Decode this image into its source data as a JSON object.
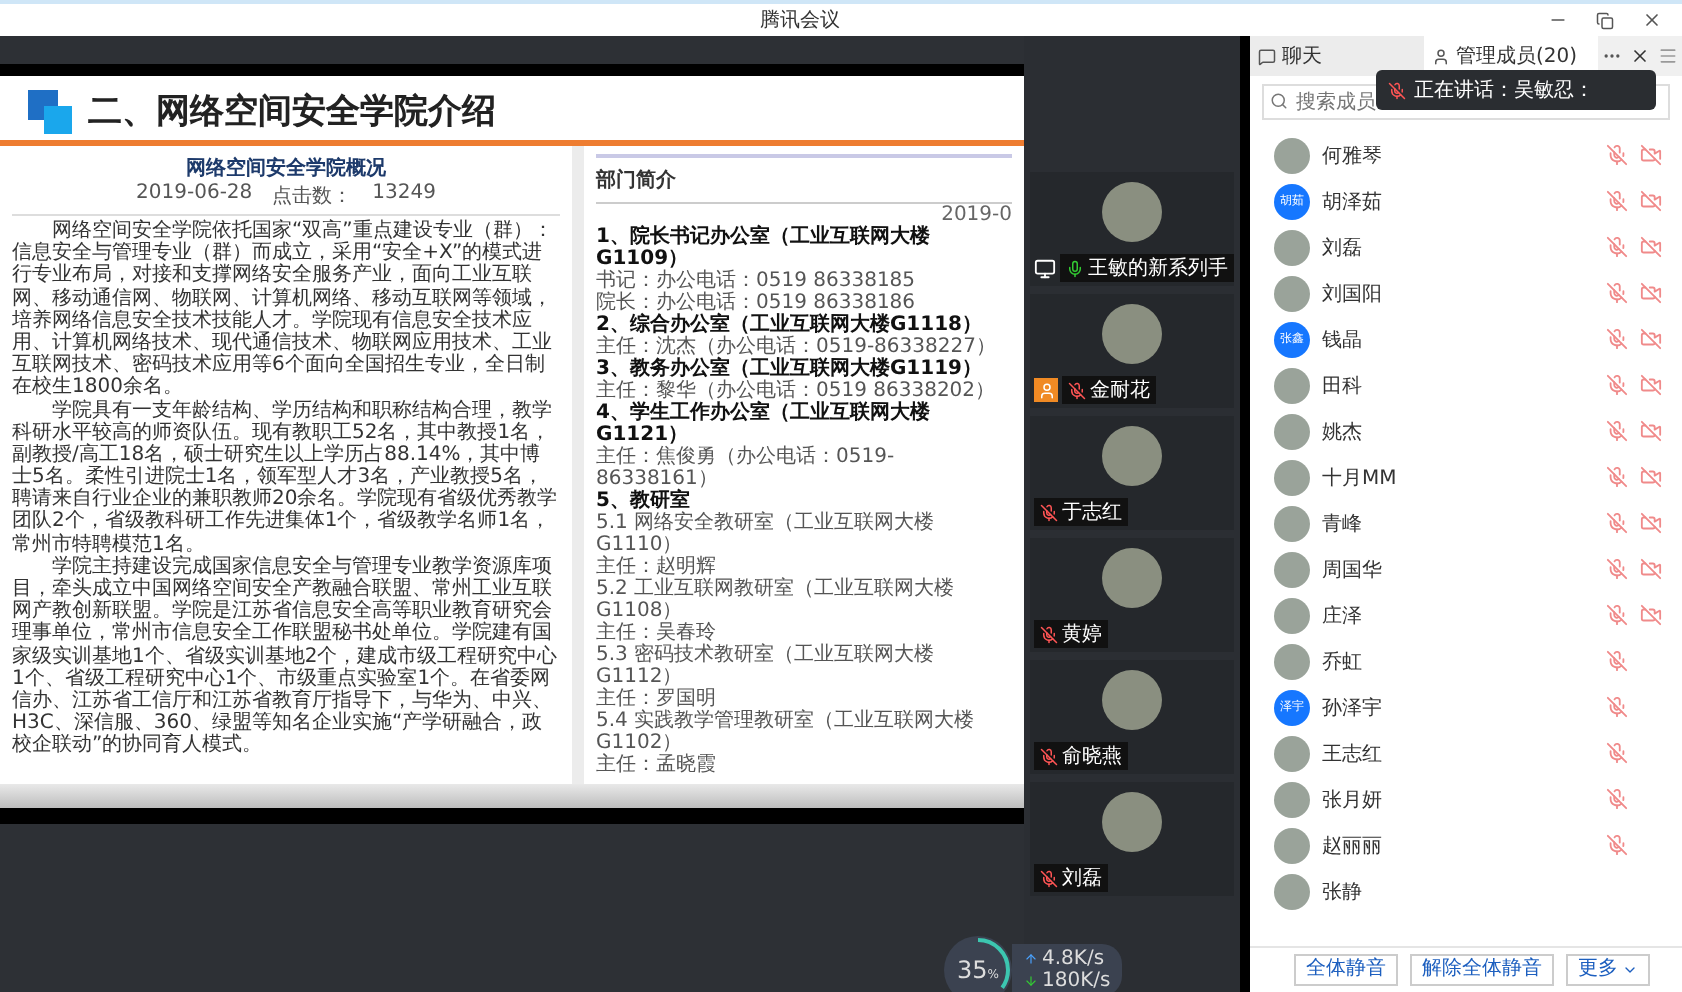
{
  "window": {
    "title": "腾讯会议"
  },
  "slide": {
    "heading": "二、网络空间安全学院介绍",
    "article": {
      "title": "网络空间安全学院概况",
      "date": "2019-06-28",
      "views_label": "点击数：",
      "views": "13249",
      "paragraphs": [
        "网络空间安全学院依托国家“双高”重点建设专业（群）：信息安全与管理专业（群）而成立，采用“安全+X”的模式进行专业布局，对接和支撑网络安全服务产业，面向工业互联网、移动通信网、物联网、计算机网络、移动互联网等领域，培养网络信息安全技术技能人才。学院现有信息安全技术应用、计算机网络技术、现代通信技术、物联网应用技术、工业互联网技术、密码技术应用等6个面向全国招生专业，全日制在校生1800余名。",
        "学院具有一支年龄结构、学历结构和职称结构合理，教学科研水平较高的师资队伍。现有教职工52名，其中教授1名，副教授/高工18名，硕士研究生以上学历占88.14%，其中博士5名。柔性引进院士1名，领军型人才3名，产业教授5名，聘请来自行业企业的兼职教师20余名。学院现有省级优秀教学团队2个，省级教科研工作先进集体1个，省级教学名师1名，常州市特聘模范1名。",
        "学院主持建设完成国家信息安全与管理专业教学资源库项目，牵头成立中国网络空间安全产教融合联盟、常州工业互联网产教创新联盟。学院是江苏省信息安全高等职业教育研究会理事单位，常州市信息安全工作联盟秘书处单位。学院建有国家级实训基地1个、省级实训基地2个，建成市级工程研究中心1个、省级工程研究中心1个、市级重点实验室1个。在省委网信办、江苏省工信厅和江苏省教育厅指导下，与华为、中兴、H3C、深信服、360、绿盟等知名企业实施“产学研融合，政校企联动”的协同育人模式。"
      ]
    },
    "sidebar": {
      "title": "部门简介",
      "date": "2019-0",
      "items": [
        {
          "kind": "heading",
          "text": "1、院长书记办公室（工业互联网大楼G1109）"
        },
        {
          "kind": "line",
          "text": "书记：办公电话：0519 86338185"
        },
        {
          "kind": "line",
          "text": "院长：办公电话：0519 86338186"
        },
        {
          "kind": "heading",
          "text": "2、综合办公室（工业互联网大楼G1118）"
        },
        {
          "kind": "line",
          "text": "主任：沈杰（办公电话：0519-86338227）"
        },
        {
          "kind": "heading",
          "text": "3、教务办公室（工业互联网大楼G1119）"
        },
        {
          "kind": "line",
          "text": "主任：黎华（办公电话：0519 86338202）"
        },
        {
          "kind": "heading",
          "text": "4、学生工作办公室（工业互联网大楼G1121）"
        },
        {
          "kind": "line",
          "text": "主任：焦俊勇（办公电话：0519-86338161）"
        },
        {
          "kind": "heading",
          "text": "5、教研室"
        },
        {
          "kind": "line",
          "text": "5.1 网络安全教研室（工业互联网大楼G1110）"
        },
        {
          "kind": "line",
          "text": "主任：赵明辉"
        },
        {
          "kind": "line",
          "text": "5.2 工业互联网教研室（工业互联网大楼G1108）"
        },
        {
          "kind": "line",
          "text": "主任：吴春玲"
        },
        {
          "kind": "line",
          "text": "5.3 密码技术教研室（工业互联网大楼G1112）"
        },
        {
          "kind": "line",
          "text": "主任：罗国明"
        },
        {
          "kind": "line",
          "text": "5.4 实践教学管理教研室（工业互联网大楼G1102）"
        },
        {
          "kind": "line",
          "text": "主任：孟晓霞"
        }
      ]
    }
  },
  "videos": [
    {
      "name": "王敏的新系列手",
      "mic_muted": false,
      "kind": "sharing"
    },
    {
      "name": "金耐花",
      "mic_muted": true,
      "kind": "badged"
    },
    {
      "name": "于志红",
      "mic_muted": true,
      "kind": "plain"
    },
    {
      "name": "黄婷",
      "mic_muted": true,
      "kind": "plain"
    },
    {
      "name": "俞晓燕",
      "mic_muted": true,
      "kind": "plain"
    },
    {
      "name": "刘磊",
      "mic_muted": true,
      "kind": "plain"
    }
  ],
  "stats": {
    "cpu": "35",
    "unit": "%",
    "level": 0.35,
    "upload": "4.8K/s",
    "download": "180K/s"
  },
  "panel": {
    "tabs": [
      {
        "label": "聊天",
        "selected": false
      },
      {
        "label": "管理成员(20)",
        "selected": true
      }
    ],
    "search": {
      "placeholder": "搜索成员"
    },
    "speaking": "正在讲话：吴敏忍：",
    "members": [
      {
        "name": "何雅琴",
        "kind": "photo",
        "mic_muted": true,
        "video_off": true
      },
      {
        "name": "胡泽茹",
        "kind": "initials",
        "initials": "胡茹",
        "mic_muted": true,
        "video_off": true
      },
      {
        "name": "刘磊",
        "kind": "photo",
        "mic_muted": true,
        "video_off": true
      },
      {
        "name": "刘国阳",
        "kind": "photo",
        "mic_muted": true,
        "video_off": true
      },
      {
        "name": "钱晶",
        "kind": "initials",
        "initials": "张鑫",
        "mic_muted": true,
        "video_off": true
      },
      {
        "name": "田科",
        "kind": "photo",
        "mic_muted": true,
        "video_off": true
      },
      {
        "name": "姚杰",
        "kind": "photo",
        "mic_muted": true,
        "video_off": true
      },
      {
        "name": "十月MM",
        "kind": "photo",
        "mic_muted": true,
        "video_off": true
      },
      {
        "name": "青峰",
        "kind": "photo",
        "mic_muted": true,
        "video_off": true
      },
      {
        "name": "周国华",
        "kind": "photo",
        "mic_muted": true,
        "video_off": true
      },
      {
        "name": "庄泽",
        "kind": "photo",
        "mic_muted": true,
        "video_off": true
      },
      {
        "name": "乔虹",
        "kind": "photo",
        "mic_muted": true,
        "video_off": false
      },
      {
        "name": "孙泽宇",
        "kind": "initials",
        "initials": "泽宇",
        "mic_muted": true,
        "video_off": false
      },
      {
        "name": "王志红",
        "kind": "photo",
        "mic_muted": true,
        "video_off": false
      },
      {
        "name": "张月妍",
        "kind": "photo",
        "mic_muted": true,
        "video_off": false
      },
      {
        "name": "赵丽丽",
        "kind": "photo",
        "mic_muted": true,
        "video_off": false
      },
      {
        "name": "张静",
        "kind": "photo",
        "mic_muted": false,
        "video_off": false
      }
    ],
    "buttons": [
      {
        "label": "全体静音"
      },
      {
        "label": "解除全体静音"
      },
      {
        "label": "更多",
        "dropdown": true
      }
    ]
  }
}
